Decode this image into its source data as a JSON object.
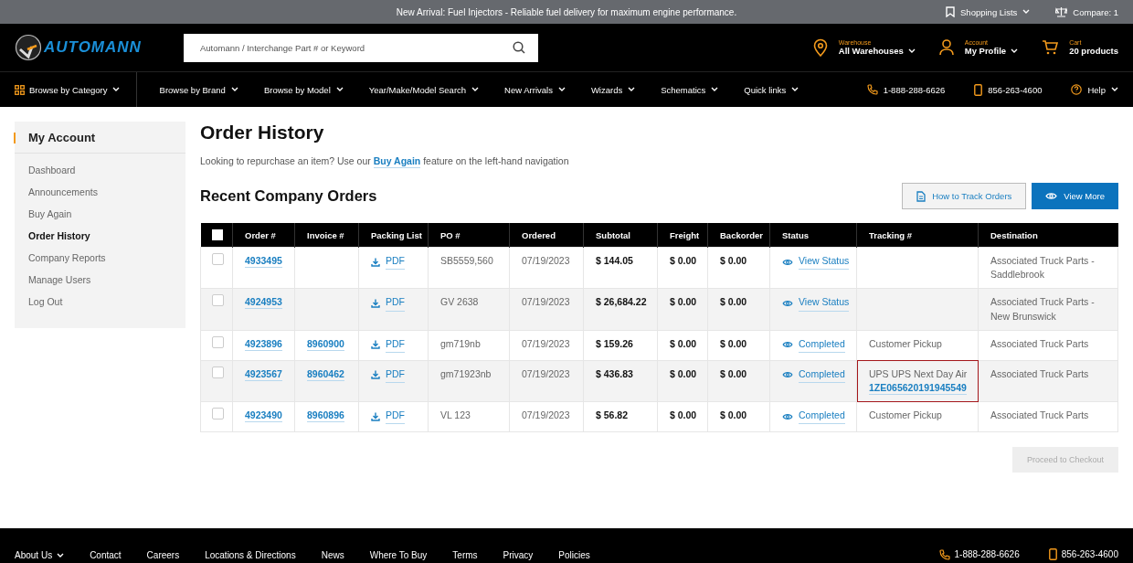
{
  "announcement": {
    "text": "New Arrival: Fuel Injectors - Reliable fuel delivery for maximum engine performance.",
    "shopping_lists": "Shopping Lists",
    "compare": "Compare: 1"
  },
  "header": {
    "logo": "AUTOMANN",
    "search": {
      "placeholder": "Automann / Interchange Part # or Keyword"
    },
    "widgets": [
      {
        "kind": "warehouse",
        "label": "Warehouse",
        "value": "All Warehouses",
        "dropdown": true
      },
      {
        "kind": "account",
        "label": "Account",
        "value": "My Profile",
        "dropdown": true
      },
      {
        "kind": "cart",
        "label": "Cart",
        "value": "20 products",
        "dropdown": false
      }
    ]
  },
  "nav": {
    "category": "Browse by Category",
    "items": [
      "Browse by Brand",
      "Browse by Model",
      "Year/Make/Model Search",
      "New Arrivals",
      "Wizards",
      "Schematics",
      "Quick links"
    ],
    "phone": "1-888-288-6626",
    "mobile": "856-263-4600",
    "help": "Help"
  },
  "sidebar": {
    "title": "My Account",
    "items": [
      {
        "label": "Dashboard",
        "selected": false
      },
      {
        "label": "Announcements",
        "selected": false
      },
      {
        "label": "Buy Again",
        "selected": false
      },
      {
        "label": "Order History",
        "selected": true
      },
      {
        "label": "Company Reports",
        "selected": false
      },
      {
        "label": "Manage Users",
        "selected": false
      },
      {
        "label": "Log Out",
        "selected": false
      }
    ]
  },
  "page": {
    "title": "Order History",
    "intro_before": "Looking to repurchase an item? Use our",
    "intro_link": "Buy Again",
    "intro_after": "feature on the left-hand navigation",
    "section_title": "Recent Company Orders",
    "track_button": "How to Track Orders",
    "view_more_button": "View More"
  },
  "table": {
    "select_all_checked": false,
    "columns": [
      "Order #",
      "Invoice #",
      "Packing List",
      "PO #",
      "Ordered",
      "Subtotal",
      "Freight",
      "Backorder",
      "Status",
      "Tracking #",
      "Destination"
    ],
    "rows": [
      {
        "checked": false,
        "order": "4933495",
        "packing": "PDF",
        "po": "SB5559,560",
        "ordered": "07/19/2023",
        "subtotal": "$ 144.05",
        "freight": "$ 0.00",
        "backorder": "$ 0.00",
        "status": "View Status",
        "destination": "Associated Truck Parts - Saddlebrook"
      },
      {
        "checked": false,
        "order": "4924953",
        "packing": "PDF",
        "po": "GV 2638",
        "ordered": "07/19/2023",
        "subtotal": "$ 26,684.22",
        "freight": "$ 0.00",
        "backorder": "$ 0.00",
        "status": "View Status",
        "destination": "Associated Truck Parts - New Brunswick"
      },
      {
        "checked": false,
        "order": "4923896",
        "invoice": "8960900",
        "packing": "PDF",
        "po": "gm719nb",
        "ordered": "07/19/2023",
        "subtotal": "$ 159.26",
        "freight": "$ 0.00",
        "backorder": "$ 0.00",
        "status": "Completed",
        "tracking": {
          "text": "Customer Pickup",
          "highlighted": false
        },
        "destination": "Associated Truck Parts"
      },
      {
        "checked": false,
        "order": "4923567",
        "invoice": "8960462",
        "packing": "PDF",
        "po": "gm71923nb",
        "ordered": "07/19/2023",
        "subtotal": "$ 436.83",
        "freight": "$ 0.00",
        "backorder": "$ 0.00",
        "status": "Completed",
        "tracking": {
          "text": "UPS UPS Next Day Air",
          "number": "1ZE065620191945549",
          "highlighted": true
        },
        "destination": "Associated Truck Parts"
      },
      {
        "checked": false,
        "order": "4923490",
        "invoice": "8960896",
        "packing": "PDF",
        "po": "VL 123",
        "ordered": "07/19/2023",
        "subtotal": "$ 56.82",
        "freight": "$ 0.00",
        "backorder": "$ 0.00",
        "status": "Completed",
        "tracking": {
          "text": "Customer Pickup",
          "highlighted": false
        },
        "destination": "Associated Truck Parts"
      }
    ]
  },
  "checkout_button": {
    "label": "Proceed to Checkout",
    "disabled": true
  },
  "footer": {
    "links": [
      {
        "label": "About Us",
        "dropdown": true
      },
      {
        "label": "Contact",
        "dropdown": false
      },
      {
        "label": "Careers",
        "dropdown": false
      },
      {
        "label": "Locations & Directions",
        "dropdown": false
      },
      {
        "label": "News",
        "dropdown": false
      },
      {
        "label": "Where To Buy",
        "dropdown": false
      },
      {
        "label": "Terms",
        "dropdown": false
      },
      {
        "label": "Privacy",
        "dropdown": false
      },
      {
        "label": "Policies",
        "dropdown": false
      }
    ],
    "phone": "1-888-288-6626",
    "mobile": "856-263-4600"
  }
}
